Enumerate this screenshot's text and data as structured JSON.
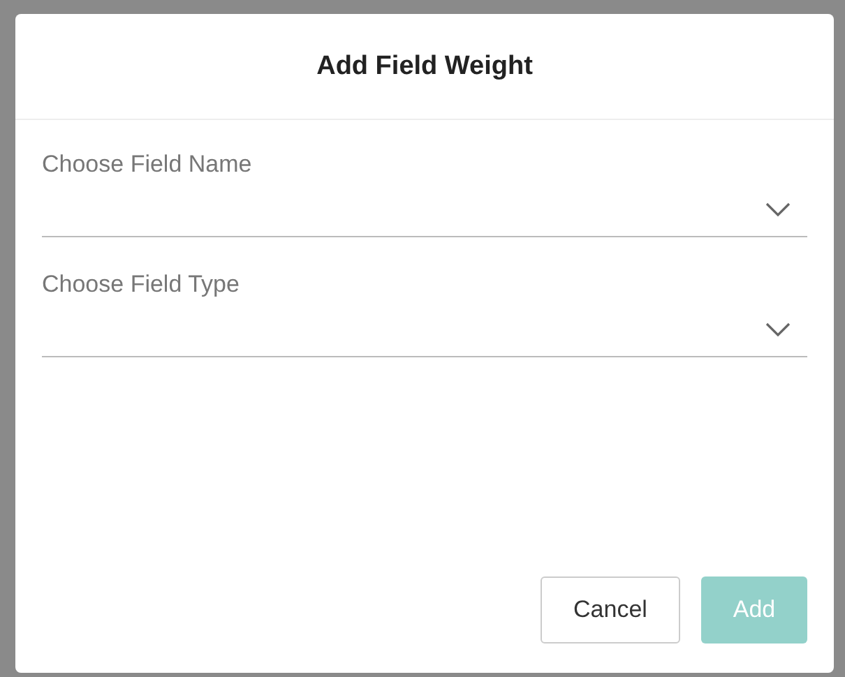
{
  "dialog": {
    "title": "Add Field Weight"
  },
  "fields": [
    {
      "label": "Choose Field Name"
    },
    {
      "label": "Choose Field Type"
    }
  ],
  "buttons": [
    {
      "label": "Cancel",
      "kind": "secondary",
      "disabled": false
    },
    {
      "label": "Add",
      "kind": "primary",
      "disabled": true
    }
  ]
}
